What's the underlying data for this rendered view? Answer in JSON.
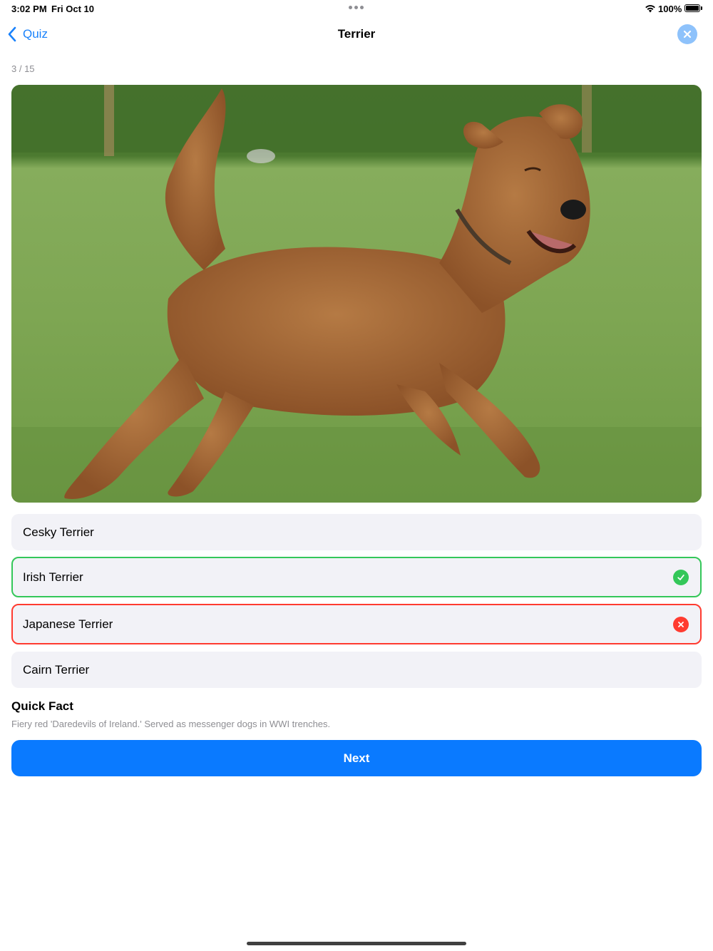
{
  "status_bar": {
    "time": "3:02 PM",
    "date": "Fri Oct 10",
    "battery_percent": "100%",
    "icons": [
      "multitasking-dots-icon",
      "wifi-icon",
      "battery-icon"
    ]
  },
  "nav": {
    "back_label": "Quiz",
    "title": "Terrier",
    "back_icon": "chevron-left-icon",
    "close_icon": "close-icon"
  },
  "progress": "3 / 15",
  "photo": {
    "subject": "dog-photo"
  },
  "options": [
    {
      "label": "Cesky Terrier",
      "state": "neutral"
    },
    {
      "label": "Irish Terrier",
      "state": "correct",
      "icon": "checkmark-circle-icon"
    },
    {
      "label": "Japanese Terrier",
      "state": "incorrect",
      "icon": "x-circle-icon"
    },
    {
      "label": "Cairn Terrier",
      "state": "neutral"
    }
  ],
  "quick_fact": {
    "title": "Quick Fact",
    "text": "Fiery red 'Daredevils of Ireland.' Served as messenger dogs in WWI trenches."
  },
  "next_button": "Next",
  "colors": {
    "accent": "#0a7aff",
    "correct": "#34c759",
    "incorrect": "#ff3b30",
    "option_bg": "#f2f2f7"
  }
}
